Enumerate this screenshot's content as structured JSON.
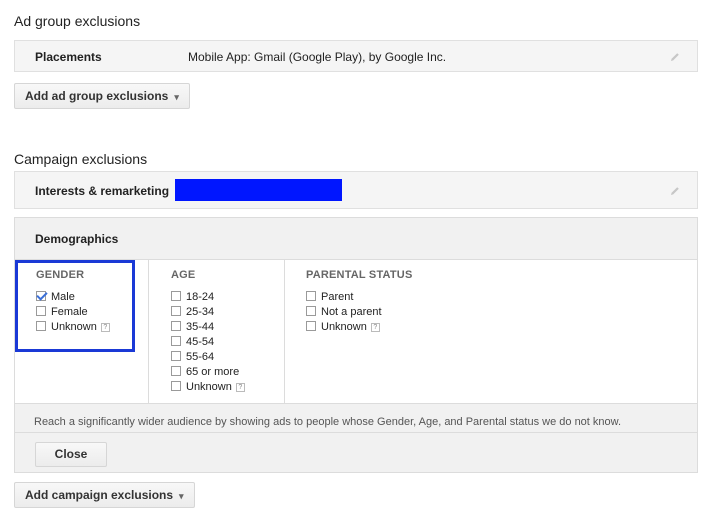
{
  "ad_group": {
    "title": "Ad group exclusions",
    "placements_label": "Placements",
    "placements_value": "Mobile App: Gmail (Google Play), by Google Inc.",
    "add_button": "Add ad group exclusions"
  },
  "campaign": {
    "title": "Campaign exclusions",
    "interests_label": "Interests & remarketing",
    "interests_value_redacted": true,
    "demographics_label": "Demographics",
    "gender": {
      "header": "GENDER",
      "options": [
        {
          "label": "Male",
          "checked": true
        },
        {
          "label": "Female",
          "checked": false
        },
        {
          "label": "Unknown",
          "checked": false,
          "help": "?"
        }
      ]
    },
    "age": {
      "header": "AGE",
      "options": [
        {
          "label": "18-24",
          "checked": false
        },
        {
          "label": "25-34",
          "checked": false
        },
        {
          "label": "35-44",
          "checked": false
        },
        {
          "label": "45-54",
          "checked": false
        },
        {
          "label": "55-64",
          "checked": false
        },
        {
          "label": "65 or more",
          "checked": false
        },
        {
          "label": "Unknown",
          "checked": false,
          "help": "?"
        }
      ]
    },
    "parental": {
      "header": "PARENTAL STATUS",
      "options": [
        {
          "label": "Parent",
          "checked": false
        },
        {
          "label": "Not a parent",
          "checked": false
        },
        {
          "label": "Unknown",
          "checked": false,
          "help": "?"
        }
      ]
    },
    "note": "Reach a significantly wider audience by showing ads to people whose Gender, Age, and Parental status we do not know.",
    "close_button": "Close",
    "add_button": "Add campaign exclusions"
  },
  "colors": {
    "redaction": "#0016ff",
    "highlight_border": "#1a39d6",
    "check": "#3a6fd8"
  },
  "icons": {
    "edit": "pencil-icon",
    "dropdown": "caret-down-icon",
    "help": "help-icon"
  }
}
